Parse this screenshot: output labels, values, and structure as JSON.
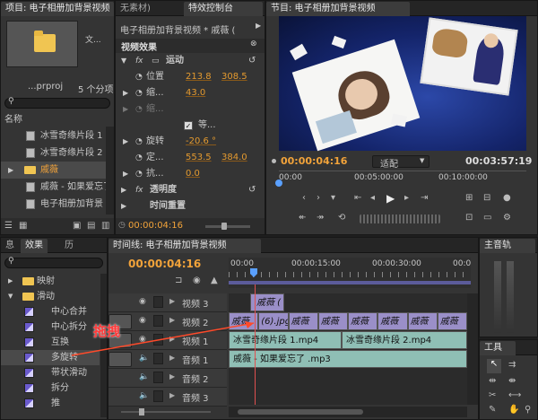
{
  "project_panel": {
    "tab_project": "项目: 电子相册加背景视频",
    "tab_media": "无素材)",
    "thumb_side": "文...",
    "file_name": "...prproj",
    "item_count": "5 个分项",
    "column_name": "名称",
    "items": [
      "冰雪奇缘片段 1",
      "冰雪奇缘片段 2",
      "戚薇",
      "戚薇 - 如果爱忘了",
      "电子相册加背景"
    ]
  },
  "effect_controls": {
    "tab": "特效控制台",
    "clip_title": "电子相册加背景视频 * 戚薇 (",
    "section": "视频效果",
    "motion": "运动",
    "position_label": "位置",
    "position_x": "213.8",
    "position_y": "308.5",
    "scale_label": "缩...",
    "scale_value": "43.0",
    "scale2_label": "缩...",
    "uniform_label": "等...",
    "rotation_label": "旋转",
    "rotation_value": "-20.6 °",
    "anchor_label": "定...",
    "anchor_x": "553.5",
    "anchor_y": "384.0",
    "flicker_label": "抗...",
    "flicker_value": "0.0",
    "opacity": "透明度",
    "time_remap": "时间重置",
    "timecode": "00:00:04:16"
  },
  "program_monitor": {
    "tab": "节目: 电子相册加背景视频",
    "current_time": "00:00:04:16",
    "fit": "适配",
    "duration": "00:03:57:19",
    "ruler": [
      "00:00",
      "00:05:00:00",
      "00:10:00:00"
    ]
  },
  "effects_panel": {
    "tab_effects": "效果",
    "tab_history": "历",
    "tab_left": "息",
    "items": [
      {
        "label": "映射",
        "type": "folder",
        "indent": 1
      },
      {
        "label": "滑动",
        "type": "folder-open",
        "indent": 1
      },
      {
        "label": "中心合并",
        "type": "effect",
        "indent": 2
      },
      {
        "label": "中心拆分",
        "type": "effect",
        "indent": 2
      },
      {
        "label": "互换",
        "type": "effect",
        "indent": 2
      },
      {
        "label": "多旋转",
        "type": "effect",
        "indent": 2
      },
      {
        "label": "带状滑动",
        "type": "effect",
        "indent": 2
      },
      {
        "label": "拆分",
        "type": "effect",
        "indent": 2
      },
      {
        "label": "推",
        "type": "effect",
        "indent": 2
      }
    ]
  },
  "timeline": {
    "tab": "时间线: 电子相册加背景视频",
    "timecode": "00:00:04:16",
    "ruler": [
      "00:00",
      "00:00:15:00",
      "00:00:30:00",
      "00:0"
    ],
    "tracks": [
      {
        "name": "视频 3"
      },
      {
        "name": "视频 2"
      },
      {
        "name": "视频 1"
      },
      {
        "name": "音频 1"
      },
      {
        "name": "音频 2"
      },
      {
        "name": "音频 3"
      }
    ],
    "v3_clip": "戚薇 (",
    "v2_clips": [
      "戚薇",
      "(6).jpg",
      "戚薇",
      "戚薇",
      "戚薇",
      "戚薇",
      "戚薇",
      "戚薇"
    ],
    "v1_clips": [
      "冰雪奇缘片段 1.mp4",
      "冰雪奇缘片段 2.mp4"
    ],
    "a1_clip": "戚薇 - 如果爱忘了 .mp3"
  },
  "annotation": "拖拽",
  "right_panels": {
    "master": "主音轨",
    "tools": "工具"
  }
}
